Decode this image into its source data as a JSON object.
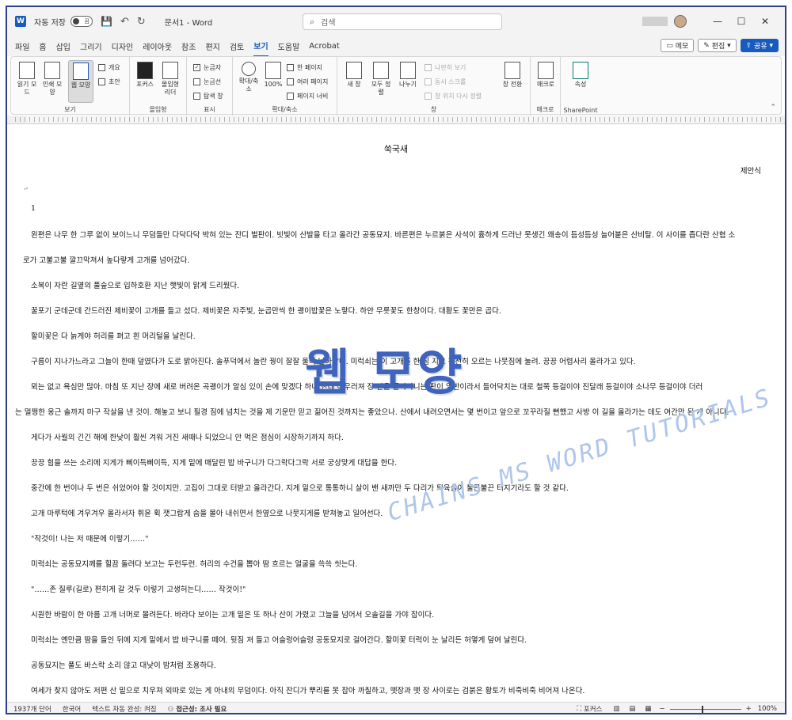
{
  "titlebar": {
    "app_badge": "W",
    "autosave_label": "자동 저장",
    "autosave_state": "끔",
    "doc_title": "문서1 - Word",
    "search_placeholder": "검색",
    "minimize": "—",
    "maximize": "☐",
    "close": "✕"
  },
  "tabs": [
    "파일",
    "홈",
    "삽입",
    "그리기",
    "디자인",
    "레이아웃",
    "참조",
    "편지",
    "검토",
    "보기",
    "도움말",
    "Acrobat"
  ],
  "active_tab": "보기",
  "tab_actions": {
    "memo": "메모",
    "edit": "편집",
    "share": "공유"
  },
  "ribbon": {
    "view": {
      "read_mode": "읽기 모드",
      "print_layout": "인쇄 모양",
      "web_layout": "웹 모양",
      "outline": "개요",
      "draft": "초안",
      "label": "보기"
    },
    "immersive": {
      "focus": "포커스",
      "reader": "몰입형 리더",
      "label": "몰입형"
    },
    "show": {
      "ruler": "눈금자",
      "gridlines": "눈금선",
      "nav": "탐색 창",
      "label": "표시"
    },
    "zoom": {
      "zoom": "확대/축소",
      "hundred": "100%",
      "one_page": "한 페이지",
      "multi_page": "여러 페이지",
      "page_width": "페이지 너비",
      "label": "확대/축소"
    },
    "window": {
      "new": "새 창",
      "arrange": "모두 정렬",
      "split": "나누기",
      "side_by_side": "나란히 보기",
      "sync_scroll": "동시 스크롤",
      "reset": "창 위치 다시 정렬",
      "switch": "창 전환",
      "label": "창"
    },
    "macros": {
      "macros": "매크로",
      "label": "매크로"
    },
    "sharepoint": {
      "props": "속성",
      "label": "SharePoint"
    }
  },
  "document": {
    "title": "쑥국새",
    "author": "제안식",
    "number": "1",
    "paragraphs": [
      "왼편은 나무 한 그루 없이 보이느니 무덤들만 다닥다닥 박혀 있는 잔디 벌판이. 빗빛이 산발을 타고 올라간 공동묘지. 바른편은 누르붉은 사석이 흉하게 드러난 못생긴 왜송이 듬성듬성 늘어붙은 산비탈. 이 사이를 좁다란 산협 소",
      "로가 고불고불 깔끄막져서 높다랗게 고개를 넘어갔다.",
      "소복이 자란 길옆의 풀숲으로 입하호환 지난 햇빛이 맑게 드리웠다.",
      "꿀포기 군데군데 간드러진 제비꽃이 고개를 들고 섰다. 제비꽃은 자주빛, 눈곱만씩 한 괭이밥꽃은 노랗다. 하얀 무릇꽃도 한창이다. 대황도 꽃만은 곱다.",
      "할미꽃은 다 늙게야 허리를 펴고 흰 머리털을 날린다.",
      "구름이 지나가느라고 그늘이 한때 덮였다가 도로 밝아진다. 솔푸덕에서 놀란 꿩이 잘잘 울며 날아간다. 미럭쇠는 이 고개를 한 짐 지고 천천히 오르는 나뭇짐에 눌려. 끙끙 어렵사리 올라가고 있다.",
      "뫼는 없고 욕심만 많아. 마침 또 지난 장에 새로 버려온 곡괭이가 알심 있이 손에 맞겠다 하니 한데 어우러져 장 안을 돌아다니는 판이 일반이라서 들어닥치는 대로 철쭉 등걸이야 진달래 등걸이야 소나무 등걸이야 더러",
      "는 멀쩡한 옹근 솔까지 마구 작살을 낸 것이. 해놓고 보니 필경 짐에 넘치는 것을 제 기운만 믿고 짊어진 것까지는 좋았으나. 산에서 내려오면서는 몇 번이고 앞으로 꼬꾸라질 뻔했고 사방 이 길을 올라가는 데도 여간만 된 게 아니다.",
      "게다가 사월의 긴긴 해에 한낮이 훨씬 겨워 거진 새때나 되었으니 안 먹은 점심이 시장하기까지 하다.",
      "끙끙 힘을 쓰는 소리에 지게가 삐이득삐이득, 지게 밑에 매달린 밥 바구니가 다그락다그락 서로 궁상맞게 대답을 한다.",
      "중간에 한 번이나 두 번은 쉬었어야 할 것이지만. 고집이 그대로 터받고 올라간다. 지게 밑으로 통통하니 살이 밴 새까만 두 다리가 퇴육살이 불끈불끈 터지기라도 할 것 같다.",
      "고개 마루턱에 겨우겨우 올라서자 휘윤 휙 잿그랍게 숨을 몰아 내쉬면서 한옆으로 나뭇지게를 받쳐놓고 일어선다.",
      "\"작것이! 나는 저 때문에 이렇기……\"",
      "미럭쇠는 공동묘지께를 힐끔 돌려다 보고는 두런두런. 허리의 수건을 뽑아 땀 흐르는 얼굴을 쓱쓱 씻는다.",
      "\"……존 질루(길로) 편히게 갈 것두 이렇기 고생허는디…… 작것이!\"",
      "시원한 바람이 한 아름 고개 너머로 몰려든다. 바라다 보이는 고개 밑은 또 하나 산이 가렸고 그늘을 넘어서 오솔길을 가야 잡이다.",
      "미럭쇠는 옌만큼 땀을 들인 뒤에 지게 밑에서 밥 바구니를 떼어. 뒷짐 져 들고 어슬렁어슬렁 공동묘지로 걸어간다. 할미꽃 터럭이 눈 날리든 허옇게 덮여 날린다.",
      "공동묘지는 풀도 바스락 소리 않고 대낮이 밤처럼 조용하다.",
      "여세가 찾지 않아도 저편 산 밑으로 치우쳐 외따로 있는 게 아내의 무덤이다. 아직 잔디가 뿌리를 못 잡아 까칠하고, 뗏장과 뗏 장 사이로는 검붉은 황토가 비죽비죽 비어져 나온다."
    ]
  },
  "watermark": {
    "title": "웹 모양",
    "brand": "CHAINS MS WORD TUTORIALS"
  },
  "statusbar": {
    "words": "1937개 단어",
    "language": "한국어",
    "predict": "텍스트 자동 완성: 켜짐",
    "accessibility": "접근성: 조사 필요",
    "focus": "포커스",
    "zoom": "100%"
  },
  "colors": {
    "accent": "#185abd",
    "frame": "#2b3f8c",
    "watermark": "#3f64bd"
  }
}
